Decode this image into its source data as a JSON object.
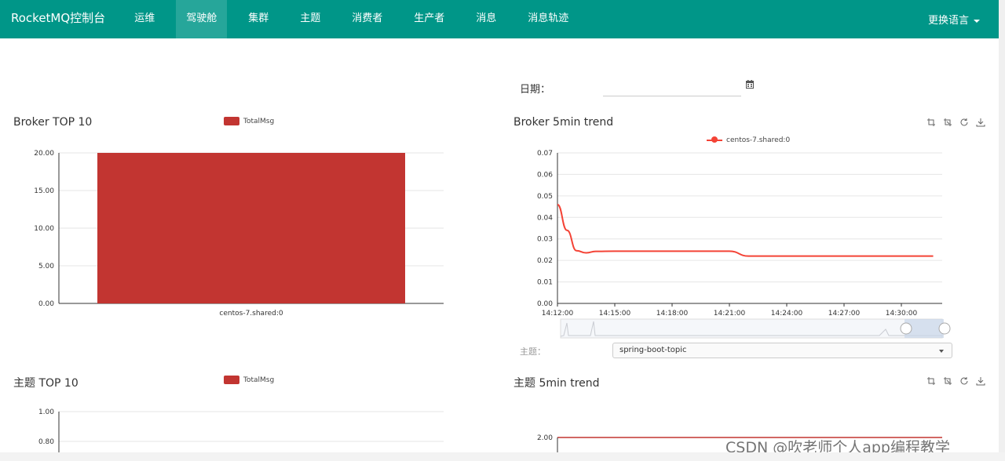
{
  "navbar": {
    "brand": "RocketMQ控制台",
    "items": [
      {
        "label": "运维"
      },
      {
        "label": "驾驶舱",
        "active": true
      },
      {
        "label": "集群"
      },
      {
        "label": "主题"
      },
      {
        "label": "消费者"
      },
      {
        "label": "生产者"
      },
      {
        "label": "消息"
      },
      {
        "label": "消息轨迹"
      }
    ],
    "language": "更换语言",
    "bg_color": "#009688"
  },
  "filters": {
    "date_label": "日期：",
    "date_value": "",
    "calendar_icon": "calendar-icon",
    "topic_label": "主题：",
    "topic_value": "spring-boot-topic"
  },
  "panels": {
    "broker_top": {
      "title": "Broker TOP 10"
    },
    "broker_trend": {
      "title": "Broker 5min trend",
      "tools": [
        "zoom-icon",
        "zoom-reset-icon",
        "restore-icon",
        "download-icon"
      ]
    },
    "topic_top": {
      "title": "主题 TOP 10"
    },
    "topic_trend": {
      "title": "主题 5min trend",
      "tools": [
        "zoom-icon",
        "zoom-reset-icon",
        "restore-icon",
        "download-icon"
      ]
    }
  },
  "chart_data": [
    {
      "type": "bar",
      "title": "Broker TOP 10",
      "legend": [
        "TotalMsg"
      ],
      "categories": [
        "centos-7.shared:0"
      ],
      "series": [
        {
          "name": "TotalMsg",
          "values": [
            20
          ]
        }
      ],
      "ylim": [
        0,
        20
      ],
      "yticks": [
        "0.00",
        "5.00",
        "10.00",
        "15.00",
        "20.00"
      ],
      "color": "#c23531",
      "grid": true
    },
    {
      "type": "line",
      "title": "Broker 5min trend",
      "legend": [
        "centos-7.shared:0"
      ],
      "x_ticks": [
        "14:12:00",
        "14:15:00",
        "14:18:00",
        "14:21:00",
        "14:24:00",
        "14:27:00",
        "14:30:00"
      ],
      "series": [
        {
          "name": "centos-7.shared:0",
          "x": [
            "14:12:00",
            "14:12:30",
            "14:13:00",
            "14:13:30",
            "14:14:00",
            "14:15:00",
            "14:18:00",
            "14:20:00",
            "14:21:00",
            "14:22:00",
            "14:24:00",
            "14:27:00",
            "14:30:00",
            "14:31:40"
          ],
          "values": [
            0.046,
            0.034,
            0.0245,
            0.0235,
            0.0242,
            0.0243,
            0.0243,
            0.0243,
            0.0243,
            0.022,
            0.022,
            0.022,
            0.022,
            0.022
          ]
        }
      ],
      "ylim": [
        0,
        0.07
      ],
      "yticks": [
        "0.00",
        "0.01",
        "0.02",
        "0.03",
        "0.04",
        "0.05",
        "0.06",
        "0.07"
      ],
      "color": "#f44336",
      "grid": true,
      "datazoom": true
    },
    {
      "type": "bar",
      "title": "主题 TOP 10",
      "legend": [
        "TotalMsg"
      ],
      "categories": [],
      "series": [
        {
          "name": "TotalMsg",
          "values": []
        }
      ],
      "ylim": [
        0,
        1
      ],
      "yticks": [
        "0.80",
        "1.00"
      ],
      "color": "#c23531",
      "grid": true
    },
    {
      "type": "line",
      "title": "主题 5min trend",
      "series": [
        {
          "name": "",
          "values": [
            2.0
          ]
        }
      ],
      "yticks": [
        "2.00"
      ],
      "color": "#c23531",
      "grid": true
    }
  ],
  "watermark": "CSDN @吹老师个人app编程教学"
}
